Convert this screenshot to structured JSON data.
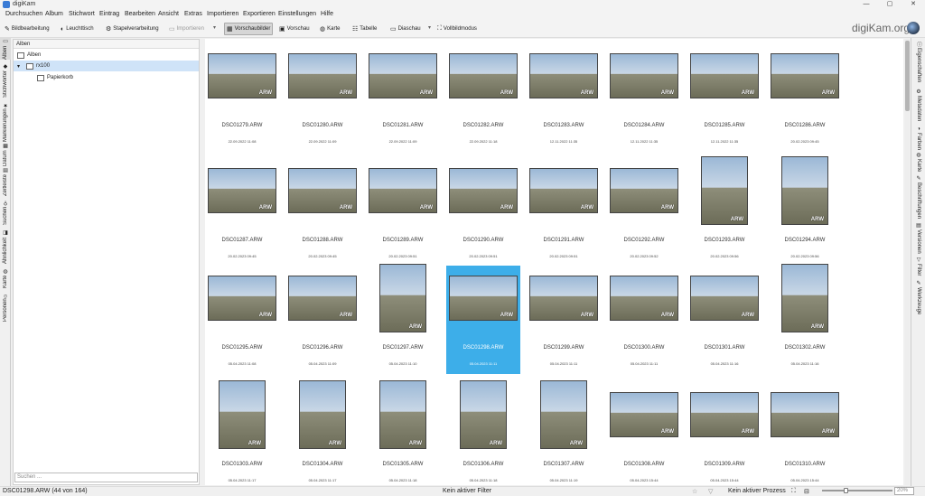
{
  "window": {
    "title": "digiKam",
    "minimize": "—",
    "maximize": "▢",
    "close": "✕"
  },
  "menu": [
    "Durchsuchen",
    "Album",
    "Stichwort",
    "Eintrag",
    "Bearbeiten",
    "Ansicht",
    "Extras",
    "Importieren",
    "Exportieren",
    "Einstellungen",
    "Hilfe"
  ],
  "toolbar": {
    "bildbearbeitung": "Bildbearbeitung",
    "leuchttisch": "Leuchttisch",
    "stapel": "Stapelverarbeitung",
    "importieren": "Importieren",
    "vorschaubilder": "Vorschaubilder",
    "vorschau": "Vorschau",
    "karte": "Karte",
    "tabelle": "Tabelle",
    "diaschau": "Diaschau",
    "vollbild": "Vollbildmodus",
    "dropdown_glyph": "▾"
  },
  "brand": "digiKam.org",
  "left_tabs": [
    "Alben",
    "Stichwörter",
    "Markierungen",
    "Datum",
    "Zeitleiste",
    "Suchen",
    "Ähnlichkeit",
    "Karte",
    "Personen"
  ],
  "right_tabs": [
    "Eigenschaften",
    "Metadaten",
    "Farben",
    "Karte",
    "Beschriftungen",
    "Versionen",
    "Filter",
    "Werkzeuge"
  ],
  "album_panel": {
    "header": "Alben",
    "root": "Alben",
    "child": "rx100",
    "trash": "Papierkorb",
    "expander": "▾",
    "search_placeholder": "Suchen ..."
  },
  "thumb_badge": "ARW",
  "items": [
    {
      "name": "DSC01279.ARW",
      "date": "22.09.2022 11:08"
    },
    {
      "name": "DSC01280.ARW",
      "date": "22.09.2022 11:09"
    },
    {
      "name": "DSC01281.ARW",
      "date": "22.09.2022 11:09"
    },
    {
      "name": "DSC01282.ARW",
      "date": "22.09.2022 11:18"
    },
    {
      "name": "DSC01283.ARW",
      "date": "12.11.2022 11:35"
    },
    {
      "name": "DSC01284.ARW",
      "date": "12.11.2022 11:35"
    },
    {
      "name": "DSC01285.ARW",
      "date": "12.11.2022 11:35"
    },
    {
      "name": "DSC01286.ARW",
      "date": "20.02.2023 09:45"
    },
    {
      "name": "DSC01287.ARW",
      "date": "20.02.2023 09:45"
    },
    {
      "name": "DSC01288.ARW",
      "date": "20.02.2023 09:45"
    },
    {
      "name": "DSC01289.ARW",
      "date": "20.02.2023 09:51"
    },
    {
      "name": "DSC01290.ARW",
      "date": "20.02.2023 09:51"
    },
    {
      "name": "DSC01291.ARW",
      "date": "20.02.2023 09:51"
    },
    {
      "name": "DSC01292.ARW",
      "date": "20.02.2023 09:52"
    },
    {
      "name": "DSC01293.ARW",
      "date": "20.02.2023 09:56"
    },
    {
      "name": "DSC01294.ARW",
      "date": "20.02.2023 09:56"
    },
    {
      "name": "DSC01295.ARW",
      "date": "05.04.2023 11:08"
    },
    {
      "name": "DSC01296.ARW",
      "date": "05.04.2023 11:09"
    },
    {
      "name": "DSC01297.ARW",
      "date": "05.04.2023 11:10"
    },
    {
      "name": "DSC01298.ARW",
      "date": "05.04.2023 11:11"
    },
    {
      "name": "DSC01299.ARW",
      "date": "05.04.2023 11:11"
    },
    {
      "name": "DSC01300.ARW",
      "date": "05.04.2023 11:11"
    },
    {
      "name": "DSC01301.ARW",
      "date": "05.04.2023 11:16"
    },
    {
      "name": "DSC01302.ARW",
      "date": "05.04.2023 11:16"
    },
    {
      "name": "DSC01303.ARW",
      "date": "05.04.2023 11:17"
    },
    {
      "name": "DSC01304.ARW",
      "date": "05.04.2023 11:17"
    },
    {
      "name": "DSC01305.ARW",
      "date": "05.04.2023 11:18"
    },
    {
      "name": "DSC01306.ARW",
      "date": "05.04.2023 11:18"
    },
    {
      "name": "DSC01307.ARW",
      "date": "05.04.2023 11:19"
    },
    {
      "name": "DSC01308.ARW",
      "date": "05.04.2023 15:44"
    },
    {
      "name": "DSC01309.ARW",
      "date": "05.04.2023 15:44"
    },
    {
      "name": "DSC01310.ARW",
      "date": "05.04.2023 15:44"
    }
  ],
  "selected_index": 19,
  "status": {
    "current": "DSC01298.ARW (44 von 164)",
    "filter": "Kein aktiver Filter",
    "process": "Kein aktiver Prozess",
    "zoom": "20%"
  },
  "colors": {
    "selection": "#3daee9"
  }
}
